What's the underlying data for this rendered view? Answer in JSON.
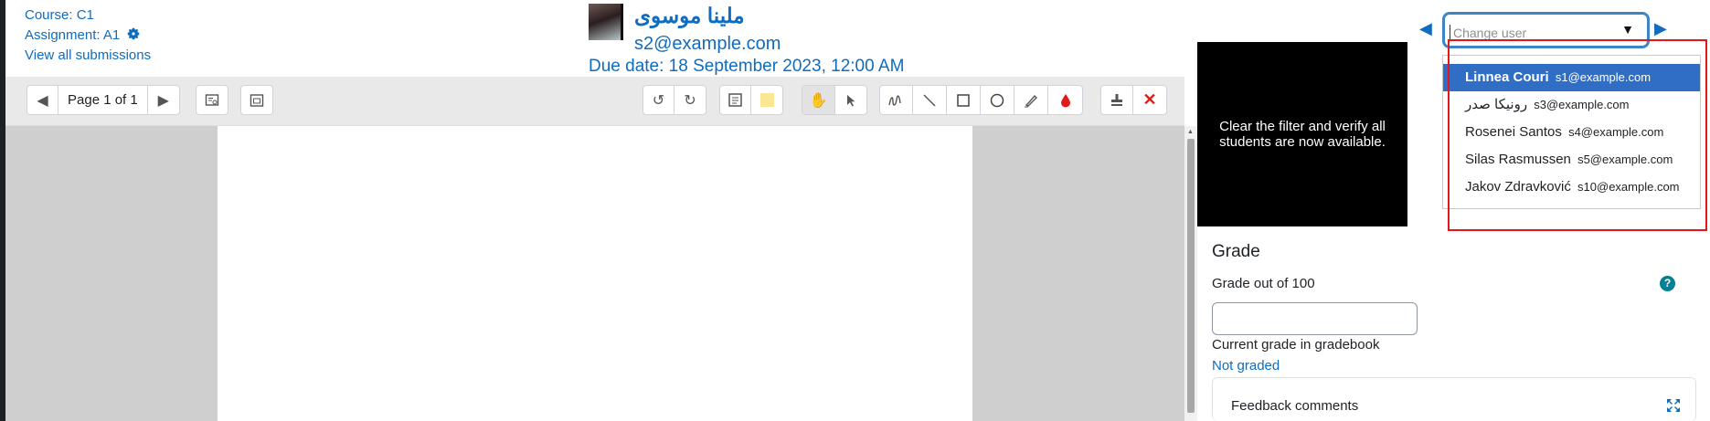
{
  "header": {
    "course": "Course: C1",
    "assignment": "Assignment: A1",
    "view_all": "View all submissions",
    "user_name": "ملينا موسوی",
    "user_email": "s2@example.com",
    "due_date": "Due date: 18 September 2023, 12:00 AM"
  },
  "change_user": {
    "placeholder": "Change user",
    "prev": "◀",
    "next": "▶",
    "arrow": "▼",
    "options": [
      {
        "name": "Linnea Couri",
        "email": "s1@example.com",
        "selected": true
      },
      {
        "name": "رونیکا صدر",
        "email": "s3@example.com"
      },
      {
        "name": "Rosenei Santos",
        "email": "s4@example.com"
      },
      {
        "name": "Silas Rasmussen",
        "email": "s5@example.com"
      },
      {
        "name": "Jakov Zdravković",
        "email": "s10@example.com"
      }
    ]
  },
  "toolbar": {
    "page_label": "Page 1 of 1"
  },
  "hint": {
    "text": "Clear the filter and verify all students are now available."
  },
  "grade": {
    "title": "Grade",
    "out_of": "Grade out of 100",
    "help": "?",
    "current": "Current grade in gradebook",
    "not_graded": "Not graded",
    "feedback": "Feedback comments"
  },
  "colors": {
    "link": "#0f6cbf",
    "selected": "#2f6ec4",
    "highlight_box": "#e3161b",
    "focus_ring": "#3d86c6"
  }
}
